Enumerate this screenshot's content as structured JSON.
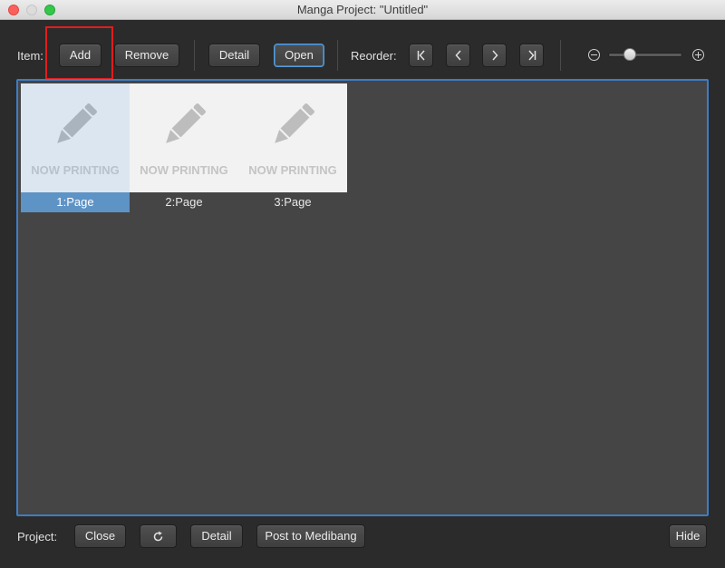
{
  "window": {
    "title": "Manga Project: \"Untitled\""
  },
  "toolbar": {
    "item_label": "Item:",
    "add_label": "Add",
    "remove_label": "Remove",
    "detail_label": "Detail",
    "open_label": "Open",
    "reorder_label": "Reorder:"
  },
  "pages": [
    {
      "placeholder": "NOW PRINTING",
      "caption": "1:Page",
      "selected": true
    },
    {
      "placeholder": "NOW PRINTING",
      "caption": "2:Page",
      "selected": false
    },
    {
      "placeholder": "NOW PRINTING",
      "caption": "3:Page",
      "selected": false
    }
  ],
  "footer": {
    "project_label": "Project:",
    "close_label": "Close",
    "detail_label": "Detail",
    "post_label": "Post to Medibang",
    "hide_label": "Hide"
  },
  "colors": {
    "accent": "#3e7cc4",
    "selection": "#5e93c6",
    "annotation": "#e11d1d"
  }
}
